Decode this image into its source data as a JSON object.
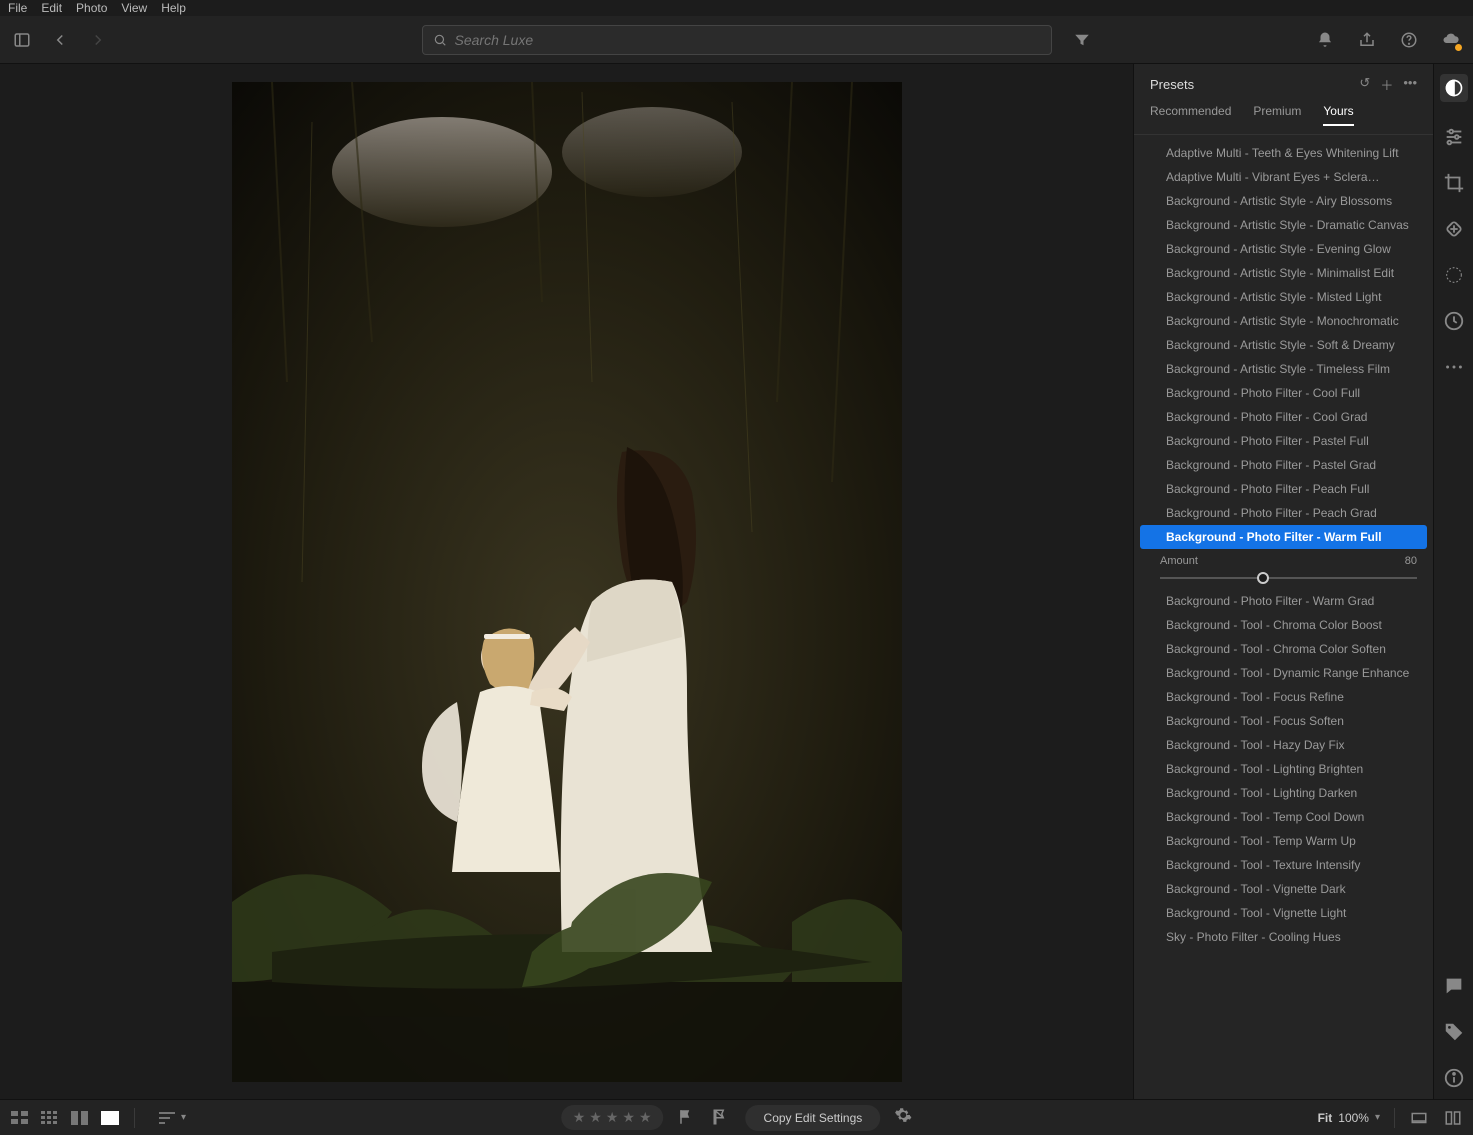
{
  "menu": {
    "items": [
      "File",
      "Edit",
      "Photo",
      "View",
      "Help"
    ]
  },
  "search": {
    "placeholder": "Search Luxe"
  },
  "presets": {
    "title": "Presets",
    "tabs": [
      "Recommended",
      "Premium",
      "Yours"
    ],
    "active_tab": 2,
    "amount_label": "Amount",
    "amount_value": "80",
    "selected_index": 16,
    "items": [
      "Adaptive Multi - Teeth & Eyes Whitening Lift",
      "Adaptive Multi - Vibrant Eyes + Sclera…",
      "Background - Artistic Style - Airy Blossoms",
      "Background - Artistic Style - Dramatic Canvas",
      "Background - Artistic Style - Evening Glow",
      "Background - Artistic Style - Minimalist Edit",
      "Background - Artistic Style - Misted Light",
      "Background - Artistic Style - Monochromatic",
      "Background - Artistic Style - Soft & Dreamy",
      "Background - Artistic Style - Timeless Film",
      "Background - Photo Filter - Cool Full",
      "Background - Photo Filter - Cool Grad",
      "Background - Photo Filter - Pastel Full",
      "Background - Photo Filter - Pastel Grad",
      "Background - Photo Filter - Peach Full",
      "Background - Photo Filter - Peach Grad",
      "Background - Photo Filter - Warm Full",
      "Background - Photo Filter - Warm Grad",
      "Background - Tool - Chroma Color Boost",
      "Background - Tool - Chroma Color Soften",
      "Background - Tool - Dynamic Range Enhance",
      "Background - Tool - Focus Refine",
      "Background - Tool - Focus Soften",
      "Background - Tool - Hazy Day Fix",
      "Background - Tool - Lighting Brighten",
      "Background - Tool - Lighting Darken",
      "Background - Tool - Temp Cool Down",
      "Background - Tool - Temp Warm Up",
      "Background - Tool - Texture Intensify",
      "Background - Tool - Vignette Dark",
      "Background - Tool - Vignette Light",
      "Sky - Photo Filter - Cooling Hues"
    ]
  },
  "bottom": {
    "copy_label": "Copy Edit Settings",
    "fit_label": "Fit",
    "zoom_value": "100%"
  }
}
